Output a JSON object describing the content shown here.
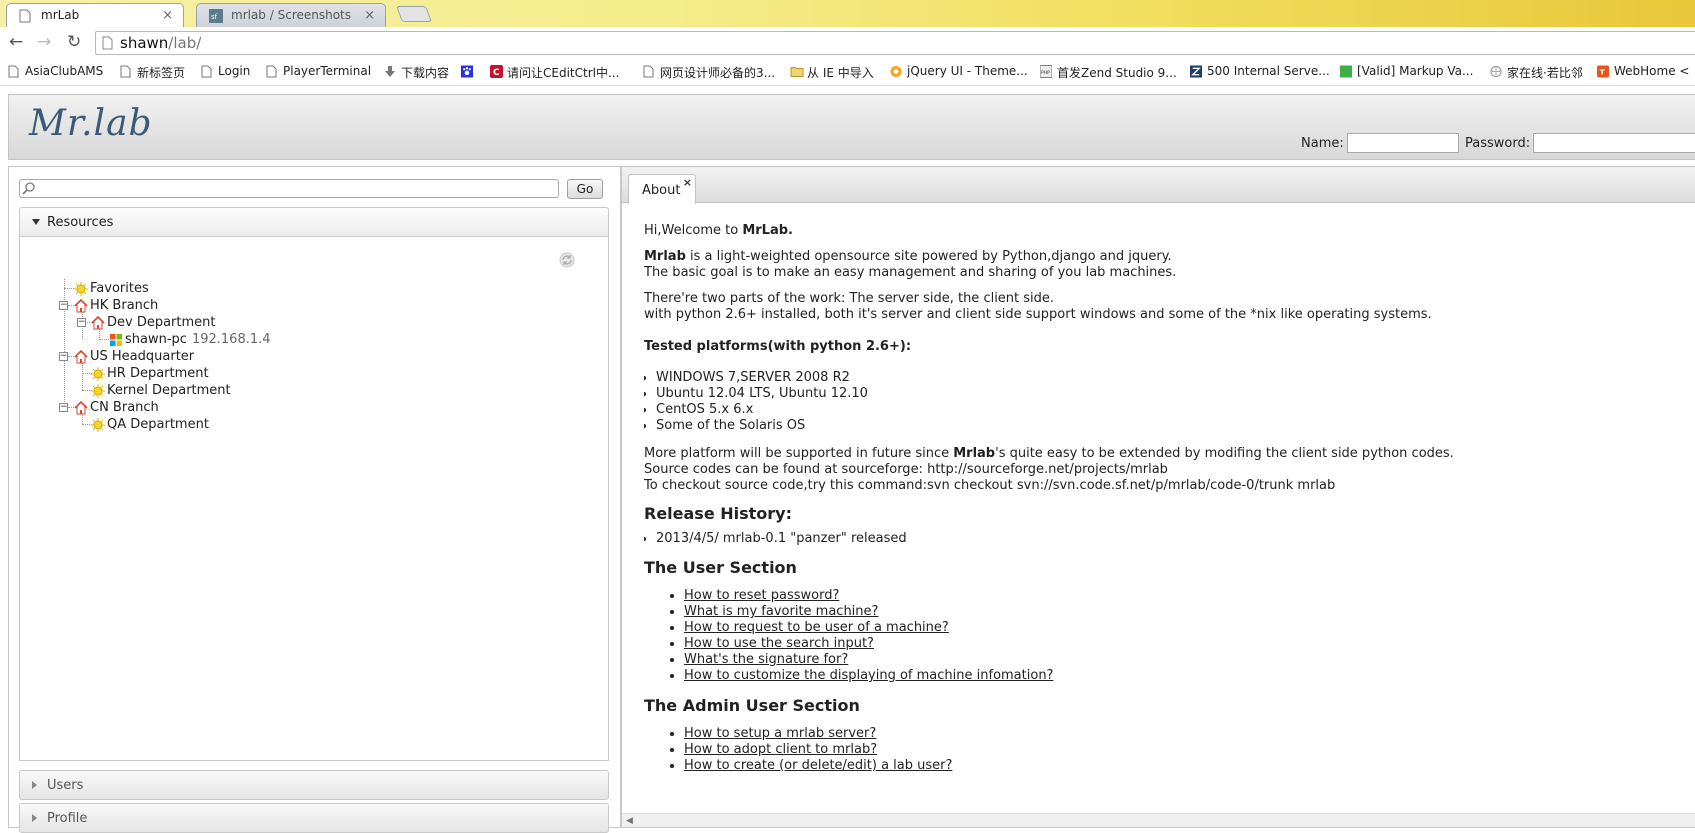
{
  "browser": {
    "tabs": [
      {
        "title": "mrLab",
        "active": true
      },
      {
        "title": "mrlab / Screenshots",
        "active": false
      }
    ],
    "url_host": "shawn",
    "url_path": "/lab/",
    "bookmarks": [
      "AsiaClubAMS",
      "新标签页",
      "Login",
      "PlayerTerminal",
      "下载内容",
      "",
      "请问让CEditCtrl中...",
      "网页设计师必备的3...",
      "从 IE 中导入",
      "jQuery UI - Theme...",
      "首发Zend Studio 9...",
      "500 Internal Serve...",
      "[Valid] Markup Va...",
      "家在线·若比邻",
      "WebHome <"
    ]
  },
  "header": {
    "logo": "Mr.lab",
    "name_label": "Name:",
    "password_label": "Password:"
  },
  "left": {
    "search_placeholder": "",
    "go_label": "Go",
    "resources_label": "Resources",
    "users_label": "Users",
    "profile_label": "Profile",
    "tree": {
      "favorites": "Favorites",
      "hk_branch": "HK Branch",
      "dev_department": "Dev Department",
      "shawn_pc": "shawn-pc",
      "shawn_pc_ip": "192.168.1.4",
      "us_hq": "US Headquarter",
      "hr_department": "HR Department",
      "kernel_department": "Kernel Department",
      "cn_branch": "CN Branch",
      "qa_department": "QA Department"
    }
  },
  "right": {
    "tab_label": "About",
    "welcome_prefix": "Hi,Welcome to ",
    "welcome_name": "MrLab.",
    "intro_brand": "Mrlab",
    "intro_line1": " is a light-weighted opensource site powered by Python,django and jquery.",
    "intro_line2": "The basic goal is to make an easy management and sharing of you lab machines.",
    "parts_line1": "There're two parts of the work: The server side, the client side.",
    "parts_line2": "with python 2.6+ installed, both it's server and client side support windows and some of the *nix like operating systems.",
    "tested_heading": "Tested platforms(with python 2.6+):",
    "platforms": [
      "WINDOWS 7,SERVER 2008 R2",
      "Ubuntu 12.04 LTS, Ubuntu 12.10",
      "CentOS 5.x 6.x",
      "Some of the Solaris OS"
    ],
    "more_prefix": "More platform will be supported in future since ",
    "more_brand": "Mrlab",
    "more_suffix": "'s quite easy to be extended by modifing the client side python codes.",
    "source_line": "Source codes can be found at sourceforge: http://sourceforge.net/projects/mrlab",
    "checkout_line": "To checkout source code,try this command:svn checkout svn://svn.code.sf.net/p/mrlab/code-0/trunk mrlab",
    "release_heading": "Release History:",
    "releases": [
      "2013/4/5/ mrlab-0.1 \"panzer\" released"
    ],
    "user_heading": "The User Section",
    "user_links": [
      "How to reset password?",
      "What is my favorite machine?",
      "How to request to be user of a machine?",
      "How to use the search input?",
      "What's the signature for?",
      "How to customize the displaying of machine infomation?"
    ],
    "admin_heading": "The Admin User Section",
    "admin_links": [
      "How to setup a mrlab server?",
      "How to adopt client to mrlab?",
      "How to create (or delete/edit) a lab user?"
    ]
  }
}
